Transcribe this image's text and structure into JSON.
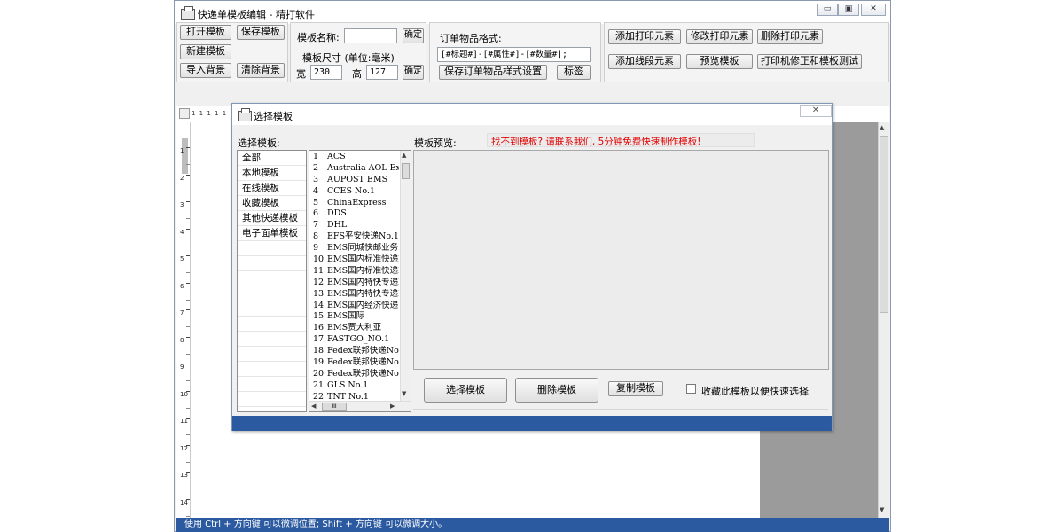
{
  "main": {
    "title": "快递单模板编辑 - 精打软件",
    "buttons": {
      "open": "打开模板",
      "save": "保存模板",
      "new": "新建模板",
      "import_bg": "导入背景",
      "clear_bg": "清除背景"
    },
    "template_name_label": "模板名称:",
    "template_name_value": "",
    "confirm_label": "确定",
    "size_label": "模板尺寸 (单位:毫米)",
    "width_label": "宽",
    "width_value": "230",
    "height_label": "高",
    "height_value": "127",
    "confirm2_label": "确定",
    "order_format_label": "订单物品格式:",
    "order_format_value": "[#标题#]-[#属性#]-[#数量#];",
    "save_order_style": "保存订单物品样式设置",
    "tag_label": "标签",
    "add_print_element": "添加打印元素",
    "edit_print_element": "修改打印元素",
    "delete_print_element": "删除打印元素",
    "add_line_element": "添加线段元素",
    "preview_template": "预览模板",
    "printer_calibrate": "打印机修正和模板测试",
    "ruler_h": "1 1 1 1 1",
    "ruler_v_numbers": [
      "1",
      "2",
      "3",
      "4",
      "5",
      "6",
      "7",
      "8",
      "9",
      "10",
      "11",
      "12",
      "13",
      "14"
    ],
    "status": "使用 Ctrl + 方向键 可以微调位置; Shift + 方向键 可以微调大小。",
    "window_controls": [
      "minimize-icon",
      "restore-icon",
      "close-icon"
    ]
  },
  "dialog": {
    "title": "选择模板",
    "select_label": "选择模板:",
    "preview_label": "模板预览:",
    "notice": "找不到模板? 请联系我们, 5分钟免费快速制作模板!",
    "notice_color": "#e00000",
    "categories": [
      "全部",
      "本地模板",
      "在线模板",
      "收藏模板",
      "其他快递模板",
      "电子面单模板"
    ],
    "templates": [
      {
        "n": "1",
        "name": "ACS"
      },
      {
        "n": "2",
        "name": "Australia AOL Ex"
      },
      {
        "n": "3",
        "name": "AUPOST EMS"
      },
      {
        "n": "4",
        "name": "CCES No.1"
      },
      {
        "n": "5",
        "name": "ChinaExpress"
      },
      {
        "n": "6",
        "name": "DDS"
      },
      {
        "n": "7",
        "name": "DHL"
      },
      {
        "n": "8",
        "name": "EFS平安快递No.1"
      },
      {
        "n": "9",
        "name": "EMS同城快邮业务:"
      },
      {
        "n": "10",
        "name": "EMS国内标准快递N"
      },
      {
        "n": "11",
        "name": "EMS国内标准快递N"
      },
      {
        "n": "12",
        "name": "EMS国内特快专递N"
      },
      {
        "n": "13",
        "name": "EMS国内特快专递N"
      },
      {
        "n": "14",
        "name": "EMS国内经济快递"
      },
      {
        "n": "15",
        "name": "EMS国际"
      },
      {
        "n": "16",
        "name": "EMS贾大利亚"
      },
      {
        "n": "17",
        "name": "FASTGO_NO.1"
      },
      {
        "n": "18",
        "name": "Fedex联邦快递No."
      },
      {
        "n": "19",
        "name": "Fedex联邦快递No."
      },
      {
        "n": "20",
        "name": "Fedex联邦快递No."
      },
      {
        "n": "21",
        "name": "GLS No.1"
      },
      {
        "n": "22",
        "name": "TNT No.1"
      }
    ],
    "select_button": "选择模板",
    "delete_button": "删除模板",
    "copy_button": "复制模板",
    "favorite_label": "收藏此模板以便快速选择",
    "favorite_checked": false,
    "hscroll_thumb": "III",
    "close_glyph": "✕"
  }
}
